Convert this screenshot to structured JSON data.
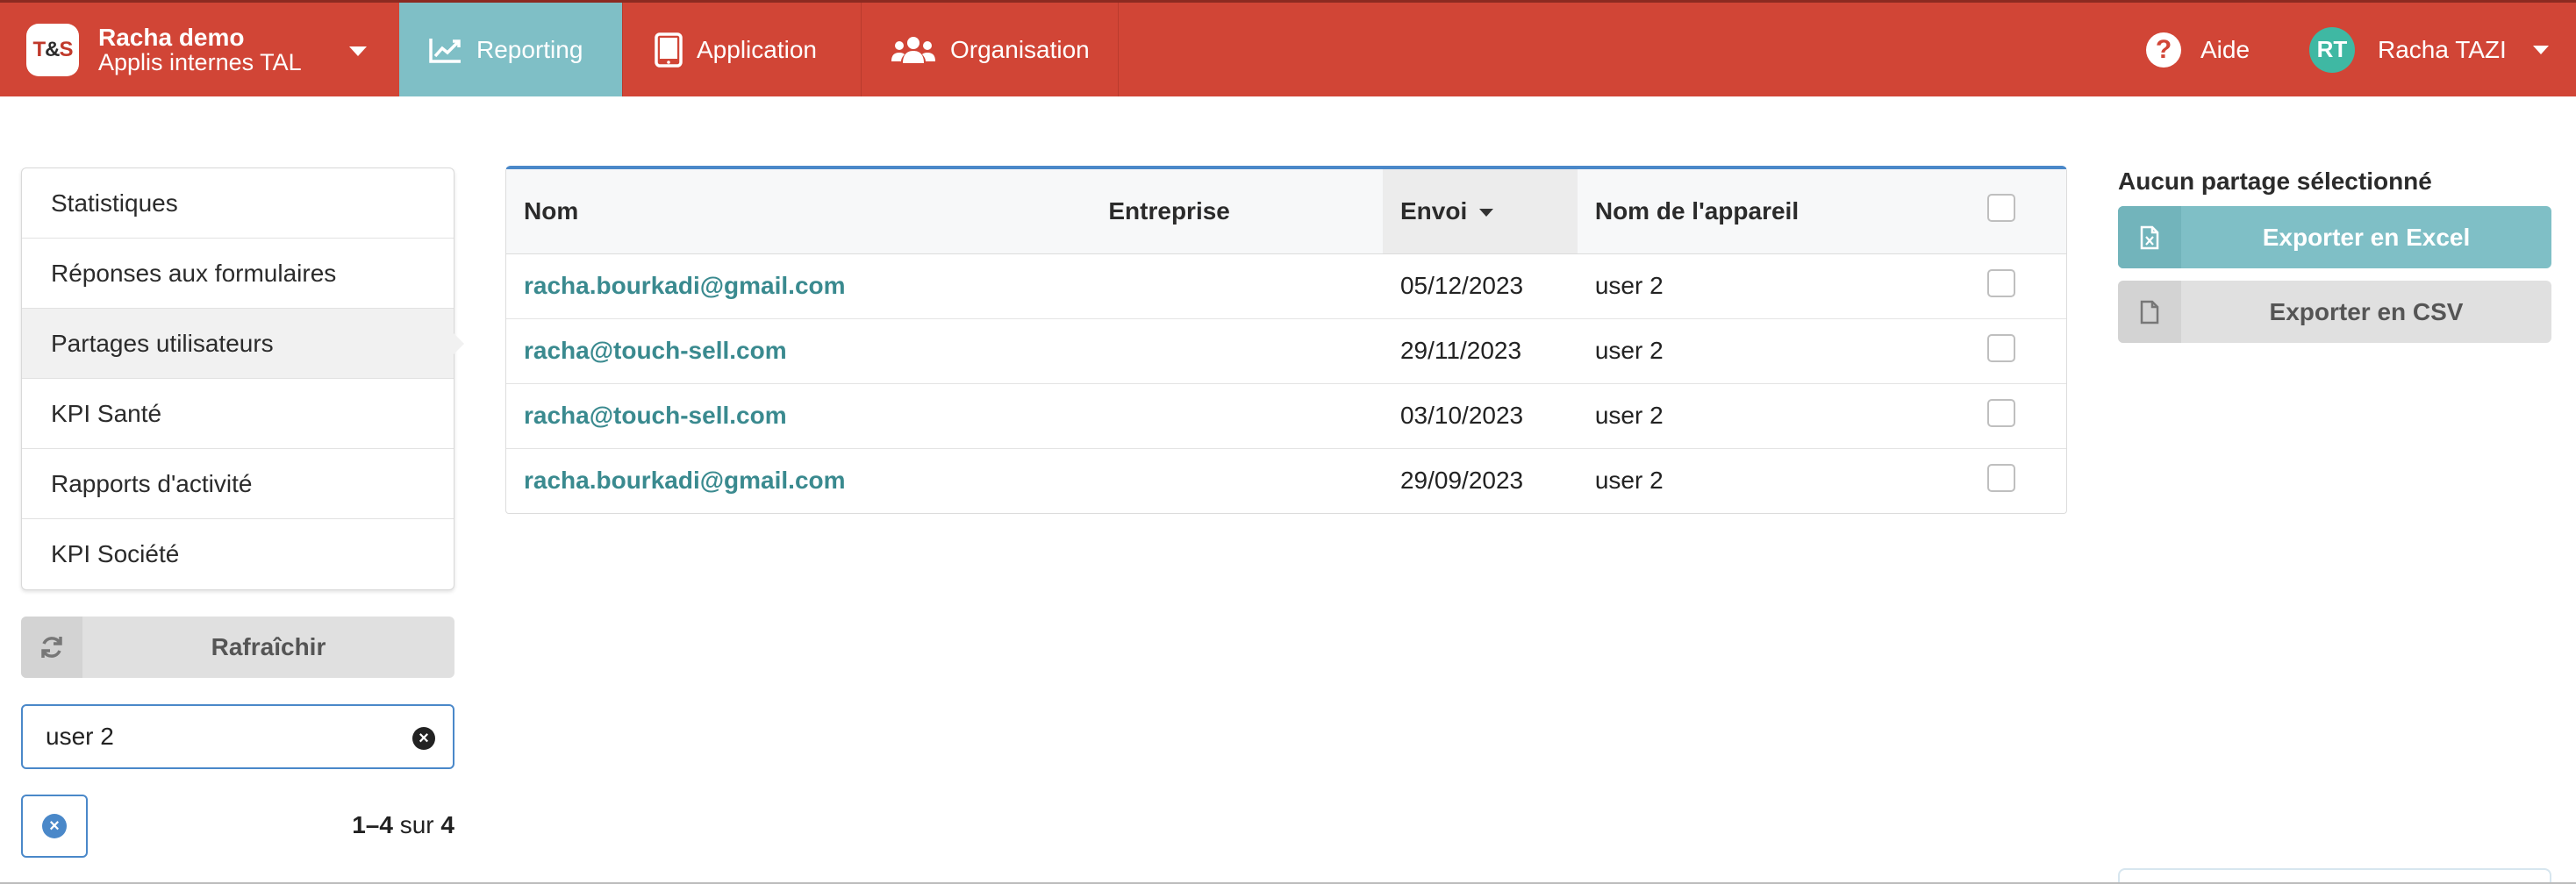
{
  "brand": {
    "logo_text": "T&S",
    "name": "Racha demo",
    "sub": "Applis internes TAL"
  },
  "nav": {
    "reporting": "Reporting",
    "application": "Application",
    "organisation": "Organisation"
  },
  "header": {
    "help": "Aide",
    "avatar_initials": "RT",
    "user_name": "Racha TAZI"
  },
  "sidebar": {
    "items": [
      {
        "label": "Statistiques"
      },
      {
        "label": "Réponses aux formulaires"
      },
      {
        "label": "Partages utilisateurs"
      },
      {
        "label": "KPI Santé"
      },
      {
        "label": "Rapports d'activité"
      },
      {
        "label": "KPI Société"
      }
    ],
    "active_index": 2,
    "refresh_label": "Rafraîchir",
    "search_value": "user 2",
    "pager": {
      "range": "1–4",
      "of": "sur",
      "total": "4"
    }
  },
  "table": {
    "headers": {
      "nom": "Nom",
      "entreprise": "Entreprise",
      "envoi": "Envoi",
      "appareil": "Nom de l'appareil"
    },
    "rows": [
      {
        "nom": "racha.bourkadi@gmail.com",
        "entreprise": "",
        "envoi": "05/12/2023",
        "appareil": "user 2"
      },
      {
        "nom": "racha@touch-sell.com",
        "entreprise": "",
        "envoi": "29/11/2023",
        "appareil": "user 2"
      },
      {
        "nom": "racha@touch-sell.com",
        "entreprise": "",
        "envoi": "03/10/2023",
        "appareil": "user 2"
      },
      {
        "nom": "racha.bourkadi@gmail.com",
        "entreprise": "",
        "envoi": "29/09/2023",
        "appareil": "user 2"
      }
    ]
  },
  "right_panel": {
    "title": "Aucun partage sélectionné",
    "export_excel": "Exporter en Excel",
    "export_csv": "Exporter en CSV"
  },
  "colors": {
    "topbar": "#d14536",
    "active_tab": "#7fbfc6",
    "link": "#3a8a8f",
    "accent_blue": "#4a88c9"
  }
}
